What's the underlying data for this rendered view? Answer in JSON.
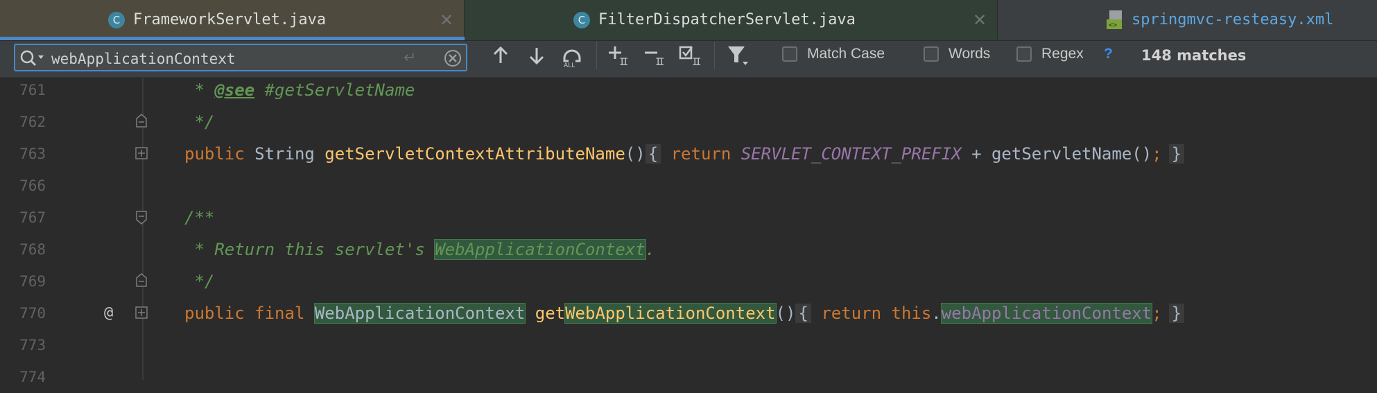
{
  "tabs": [
    {
      "label": "FrameworkServlet.java",
      "icon": "class-icon",
      "icon_letter": "C",
      "active": true
    },
    {
      "label": "FilterDispatcherServlet.java",
      "icon": "class-icon",
      "icon_letter": "C",
      "active": false
    },
    {
      "label": "springmvc-resteasy.xml",
      "icon": "xml-file-icon",
      "active": false
    }
  ],
  "find": {
    "query": "webApplicationContext",
    "options": [
      {
        "label": "Match Case",
        "checked": false
      },
      {
        "label": "Words",
        "checked": false
      },
      {
        "label": "Regex",
        "checked": false
      }
    ],
    "help": "?",
    "matches": "148 matches"
  },
  "editor": {
    "line_numbers": [
      "761",
      "762",
      "763",
      "766",
      "767",
      "768",
      "769",
      "770",
      "773",
      "774"
    ],
    "lines": {
      "l761": {
        "star": " * ",
        "tag": "@see",
        "rest": " #getServletName"
      },
      "l762": {
        "text": " */"
      },
      "l763": {
        "kw": "public",
        "type": " String ",
        "fn": "getServletContextAttributeName",
        "paren": "()",
        "ob": "{",
        "ret": " return ",
        "const": "SERVLET_CONTEXT_PREFIX",
        "plus": " + getServletName()",
        "semi": ";",
        "cb": "}"
      },
      "l767": {
        "text": "/**"
      },
      "l768": {
        "prefix": " * Return this servlet's ",
        "hl": "WebApplicationContext",
        "suffix": "."
      },
      "l769": {
        "text": " */"
      },
      "l770": {
        "kw1": "public",
        "kw2": "final",
        "type": "WebApplicationContext",
        "fnpre": "get",
        "fnhl": "WebApplicationContext",
        "paren": "()",
        "ob": "{",
        "ret": " return ",
        "this": "this",
        "dot": ".",
        "field": "webApplicationContext",
        "semi": ";",
        "cb": "}",
        "annotation_gutter": "@"
      }
    }
  },
  "colors": {
    "accent": "#4a88c7",
    "match_highlight": "#32593d",
    "keyword": "#cc7832",
    "method": "#ffc66d",
    "comment": "#629755",
    "constant": "#9876aa"
  }
}
